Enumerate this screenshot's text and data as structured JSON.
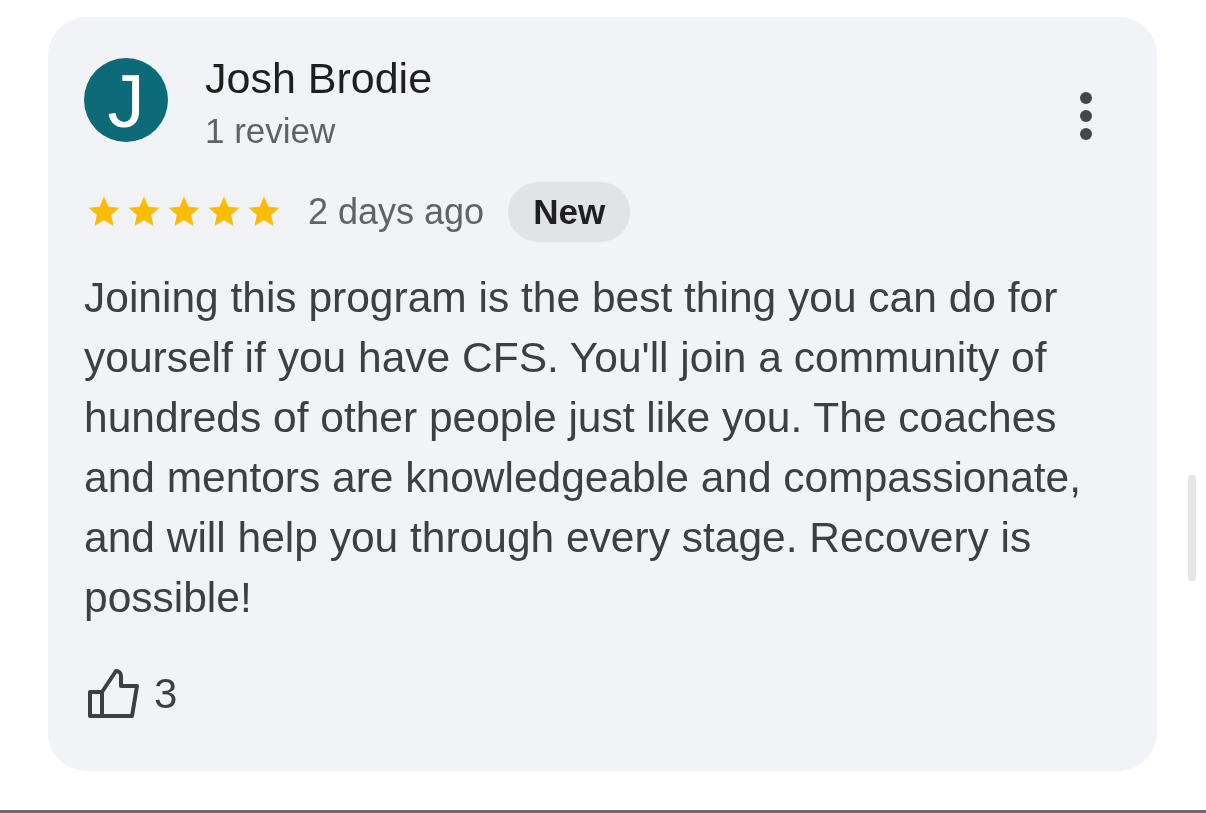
{
  "review": {
    "author": {
      "initial": "J",
      "name": "Josh Brodie",
      "review_count": "1 review"
    },
    "stars": 5,
    "time": "2 days ago",
    "badge": "New",
    "text": "Joining this program is the best thing you can do for yourself if you have CFS. You'll join a community of hundreds of other people just like you. The coaches and mentors are knowledgeable and compassionate, and will help you through every stage. Recovery is possible!",
    "likes": "3"
  }
}
